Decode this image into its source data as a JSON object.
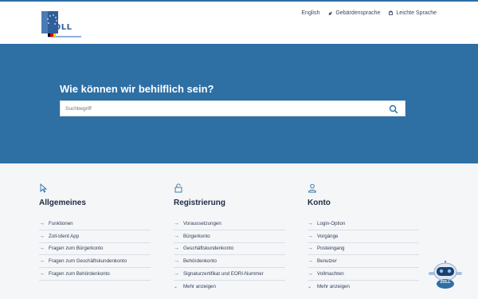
{
  "header": {
    "logo_text": "ZOLL",
    "links": [
      {
        "label": "English",
        "icon": ""
      },
      {
        "label": "Gebärdensprache",
        "icon": "hand-sign-icon"
      },
      {
        "label": "Leichte Sprache",
        "icon": "easy-language-icon"
      }
    ]
  },
  "hero": {
    "title": "Wie können wir behilflich sein?",
    "search_placeholder": "Suchbegriff"
  },
  "columns": [
    {
      "title": "Allgemeines",
      "icon": "cursor-icon",
      "items": [
        "Funktionen",
        "Zoll-Ident App",
        "Fragen zum Bürgerkonto",
        "Fragen zum Geschäftskundenkonto",
        "Fragen zum Behördenkonto"
      ]
    },
    {
      "title": "Registrierung",
      "icon": "lock-icon",
      "items": [
        "Voraussetzungen",
        "Bürgerkonto",
        "Geschäftskundenkonto",
        "Behördenkonto",
        "Signaturzertifikat und EORI-Nummer"
      ],
      "more": "Mehr anzeigen"
    },
    {
      "title": "Konto",
      "icon": "user-icon",
      "items": [
        "Login-Option",
        "Vorgänge",
        "Posteingang",
        "Benutzer",
        "Vollmachten"
      ],
      "more": "Mehr anzeigen"
    }
  ],
  "chatbot": {
    "label": "ZOLL"
  },
  "colors": {
    "primary": "#2e6fa4",
    "text": "#1d2b44",
    "background": "#f5f6f8"
  }
}
